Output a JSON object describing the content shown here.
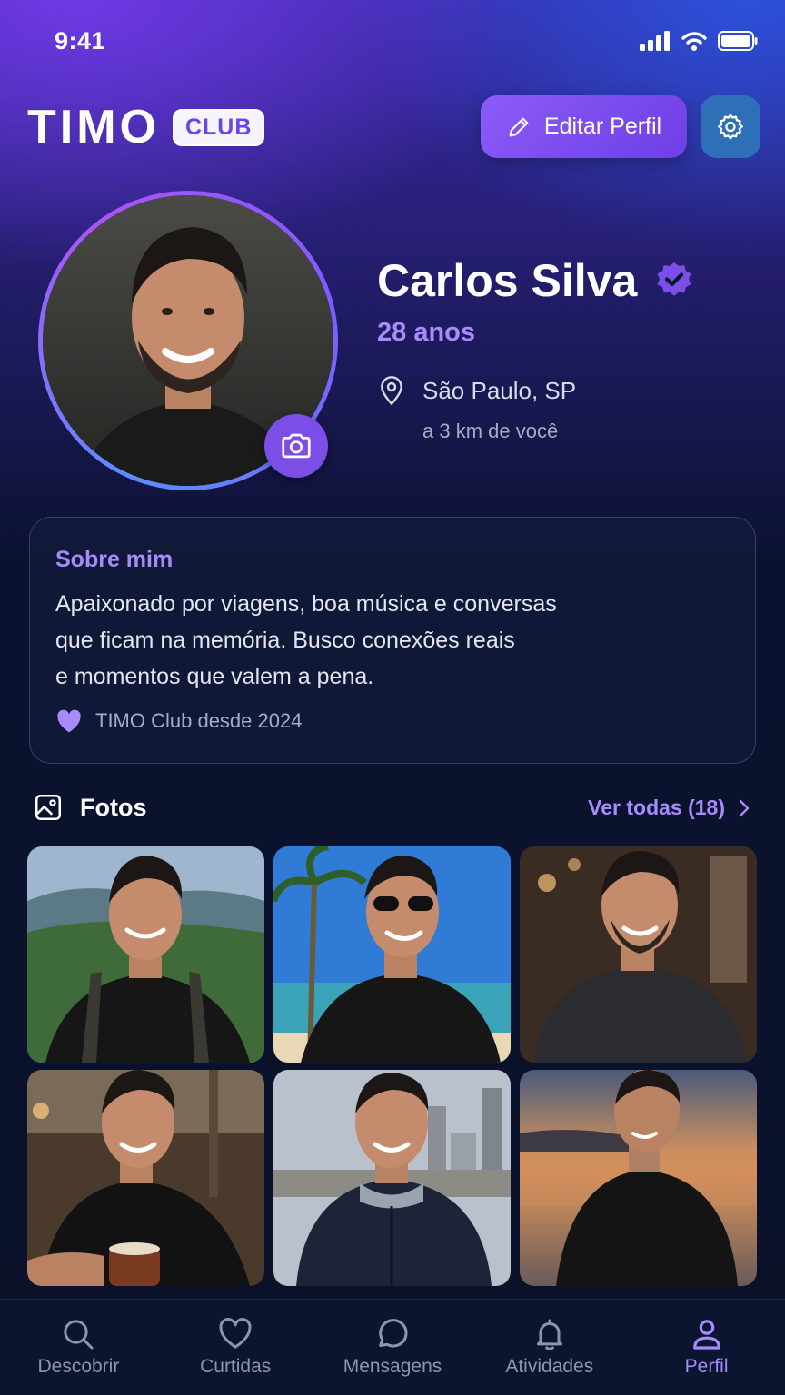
{
  "status_bar": {
    "time": "9:41"
  },
  "header": {
    "logo_word": "TIMO",
    "logo_badge": "CLUB",
    "edit_button_label": "Editar Perfil"
  },
  "profile": {
    "name": "Carlos Silva",
    "age": "28 anos",
    "location": "São Paulo, SP",
    "distance": "a 3 km de você"
  },
  "about": {
    "title": "Sobre mim",
    "lines": [
      "Apaixonado por viagens, boa música e conversas",
      "que ficam na memória. Busco conexões reais",
      "e momentos que valem a pena."
    ],
    "member_since": "TIMO Club desde 2024"
  },
  "photos": {
    "title": "Fotos",
    "see_all": "Ver todas (18)"
  },
  "tabs": [
    {
      "label": "Descobrir",
      "icon": "search-icon"
    },
    {
      "label": "Curtidas",
      "icon": "heart-icon"
    },
    {
      "label": "Mensagens",
      "icon": "chat-bubble-icon"
    },
    {
      "label": "Atividades",
      "icon": "bell-icon"
    },
    {
      "label": "Perfil",
      "icon": "user-icon",
      "active": true
    }
  ],
  "colors": {
    "accent": "#a78bfa",
    "button": "#7c4ee8",
    "background": "#0a1128"
  }
}
